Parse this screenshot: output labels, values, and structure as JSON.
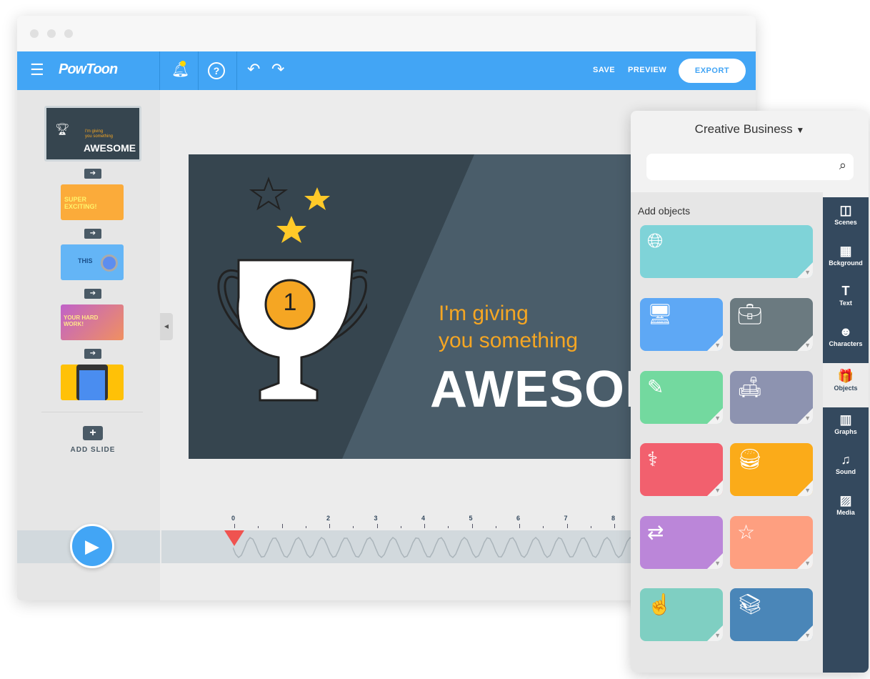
{
  "app": {
    "logo": "PowToon"
  },
  "toolbar": {
    "save": "SAVE",
    "preview": "PREVIEW",
    "export": "EXPORT",
    "icons": [
      "menu-icon",
      "bell-icon",
      "help-icon",
      "undo-icon",
      "redo-icon"
    ]
  },
  "slides": {
    "thumb1": {
      "line1": "I'm giving",
      "line2": "you something",
      "title": "AWESOME"
    },
    "thumb2": {
      "title": "SUPER EXCITING!"
    },
    "thumb3": {
      "title": "THIS"
    },
    "thumb4": {
      "title": "YOUR HARD WORK!"
    },
    "add_slide": "ADD SLIDE"
  },
  "stage": {
    "line1": "I'm giving",
    "line2": "you something",
    "title": "AWESOME",
    "badge": "1",
    "colors": {
      "bg": "#36454f",
      "accent": "#f5a623"
    }
  },
  "timeline": {
    "ticks": [
      "0",
      "2",
      "3",
      "4",
      "5",
      "6",
      "7",
      "8"
    ]
  },
  "panel": {
    "category": "Creative Business",
    "search_placeholder": "",
    "section": "Add objects",
    "tiles": [
      {
        "icon": "globe-hand-icon",
        "color": "#7fd3d8"
      },
      {
        "icon": "monitor-icon",
        "color": "#5ea8f5"
      },
      {
        "icon": "briefcase-icon",
        "color": "#6b7a80"
      },
      {
        "icon": "sign-icon",
        "color": "#73d99f"
      },
      {
        "icon": "armchair-icon",
        "color": "#8d93b0"
      },
      {
        "icon": "stethoscope-icon",
        "color": "#f2606e"
      },
      {
        "icon": "burger-icon",
        "color": "#fbab19"
      },
      {
        "icon": "arrows-icon",
        "color": "#bb86d9"
      },
      {
        "icon": "phone-star-icon",
        "color": "#fe9f80"
      },
      {
        "icon": "hand-pointer-icon",
        "color": "#7fcfc2"
      },
      {
        "icon": "books-icon",
        "color": "#4a86b8"
      }
    ]
  },
  "rsidebar": [
    {
      "label": "Scenes",
      "icon": "scenes-icon",
      "glyph": "◫"
    },
    {
      "label": "Bckground",
      "icon": "background-icon",
      "glyph": "▦"
    },
    {
      "label": "Text",
      "icon": "text-icon",
      "glyph": "T"
    },
    {
      "label": "Characters",
      "icon": "characters-icon",
      "glyph": "☻"
    },
    {
      "label": "Objects",
      "icon": "objects-icon",
      "glyph": "🎁",
      "active": true
    },
    {
      "label": "Graphs",
      "icon": "graphs-icon",
      "glyph": "▥"
    },
    {
      "label": "Sound",
      "icon": "sound-icon",
      "glyph": "♫"
    },
    {
      "label": "Media",
      "icon": "media-icon",
      "glyph": "▨"
    }
  ]
}
